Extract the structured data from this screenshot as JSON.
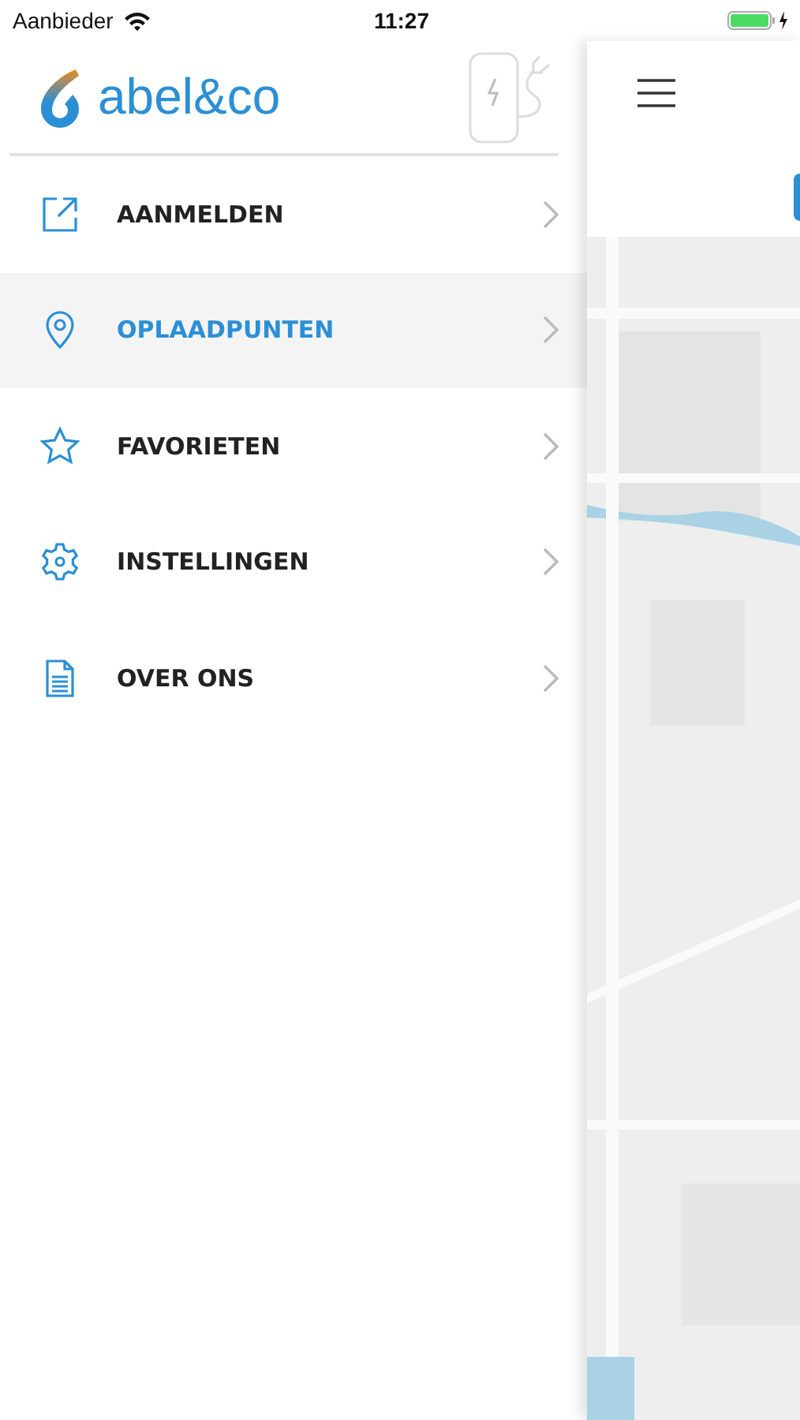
{
  "status_bar": {
    "carrier": "Aanbieder",
    "time": "11:27"
  },
  "drawer": {
    "logo": "abel&co",
    "items": [
      {
        "label": "AANMELDEN",
        "selected": false
      },
      {
        "label": "OPLAADPUNTEN",
        "selected": true
      },
      {
        "label": "FAVORIETEN",
        "selected": false
      },
      {
        "label": "INSTELLINGEN",
        "selected": false
      },
      {
        "label": "OVER ONS",
        "selected": false
      }
    ]
  }
}
